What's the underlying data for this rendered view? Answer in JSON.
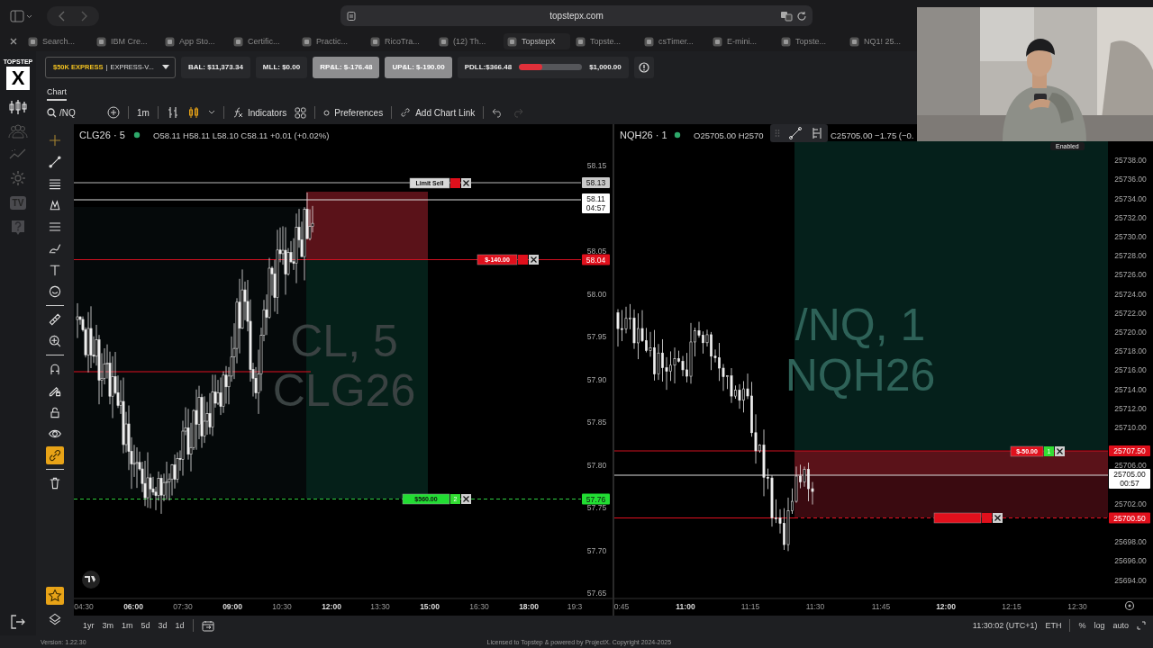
{
  "browser": {
    "url": "topstepx.com",
    "tabs": [
      {
        "label": "Search...",
        "selected": false
      },
      {
        "label": "IBM Cre...",
        "selected": false
      },
      {
        "label": "App Sto...",
        "selected": false
      },
      {
        "label": "Certific...",
        "selected": false
      },
      {
        "label": "Practic...",
        "selected": false
      },
      {
        "label": "RicoTra...",
        "selected": false
      },
      {
        "label": "(12) Th...",
        "selected": false
      },
      {
        "label": "TopstepX",
        "selected": true
      },
      {
        "label": "Topste...",
        "selected": false
      },
      {
        "label": "csTimer...",
        "selected": false
      },
      {
        "label": "E-mini...",
        "selected": false
      },
      {
        "label": "Topste...",
        "selected": false
      },
      {
        "label": "NQ1! 25...",
        "selected": false
      }
    ]
  },
  "logo": {
    "top": "TOPSTEP",
    "mark": "X"
  },
  "rail": {
    "tv_badge": "TV"
  },
  "account": {
    "plan": "$50K EXPRESS",
    "separator": "|",
    "name": "EXPRESS-V...",
    "stats": [
      {
        "label": "BAL: $11,373.34",
        "kind": "plain"
      },
      {
        "label": "MLL: $0.00",
        "kind": "plain"
      },
      {
        "label": "RP&L: $-176.48",
        "kind": "highlight"
      },
      {
        "label": "UP&L: $-190.00",
        "kind": "highlight"
      }
    ],
    "pdll": {
      "label": "PDLL:$366.48",
      "level": 0.37,
      "limit": "$1,000.00"
    }
  },
  "chart_tabs": [
    {
      "label": "Chart",
      "selected": true
    }
  ],
  "toolbar": {
    "symbol": "/NQ",
    "interval": "1m",
    "indicators": "Indicators",
    "preferences": "Preferences",
    "chart_link": "Add Chart Link"
  },
  "drawing_tools": [
    {
      "selected": false
    },
    {
      "selected": false
    },
    {
      "selected": false
    },
    {
      "selected": false
    },
    {
      "selected": false
    },
    {
      "selected": false
    },
    {
      "selected": false
    },
    {
      "selected": false
    },
    {
      "selected": false
    },
    {
      "selected": false
    },
    {
      "selected": false
    },
    {
      "selected": false
    },
    {
      "selected": false
    },
    {
      "selected": false
    },
    {
      "selected": true
    },
    {
      "selected": false
    }
  ],
  "favorites": {
    "selected": true
  },
  "charts": [
    {
      "symbol": "CLG26 · 5",
      "ohlc": [
        "O58.11 H58.11 L58.10 C58.11 +0.01 (+0.02%)"
      ],
      "watermark": [
        "CL, 5",
        "CLG26"
      ],
      "yticks": [
        "58.15",
        "58.05",
        "58.00",
        "57.95",
        "57.90",
        "57.85",
        "57.80",
        "57.75",
        "57.70",
        "57.65"
      ],
      "xticks": [
        {
          "label": "04:30",
          "major": false
        },
        {
          "label": "06:00",
          "major": true
        },
        {
          "label": "07:30",
          "major": false
        },
        {
          "label": "09:00",
          "major": true
        },
        {
          "label": "10:30",
          "major": false
        },
        {
          "label": "12:00",
          "major": true
        },
        {
          "label": "13:30",
          "major": false
        },
        {
          "label": "15:00",
          "major": true
        },
        {
          "label": "16:30",
          "major": false
        },
        {
          "label": "18:00",
          "major": true
        },
        {
          "label": "19:3",
          "major": false
        }
      ],
      "price_tags": [
        {
          "label": "58.13",
          "kind": "order"
        },
        {
          "label": "58.11",
          "sub": "04:57",
          "kind": "last"
        },
        {
          "label": "58.04",
          "kind": "loss"
        },
        {
          "label": "57.76",
          "kind": "profit"
        }
      ],
      "orders": [
        {
          "label": "Limit Sell",
          "kind": "pending"
        },
        {
          "label": "$-140.00",
          "kind": "loss"
        },
        {
          "label": "$560.00",
          "qty": "2",
          "kind": "profit"
        }
      ]
    },
    {
      "symbol": "NQH26 · 1",
      "ohlc": [
        "O25705.00 H2570",
        "C25705.00 −1.75 (−0."
      ],
      "watermark": [
        "/NQ, 1",
        "NQH26"
      ],
      "yticks": [
        "25738.00",
        "25736.00",
        "25734.00",
        "25732.00",
        "25730.00",
        "25728.00",
        "25726.00",
        "25724.00",
        "25722.00",
        "25720.00",
        "25718.00",
        "25716.00",
        "25714.00",
        "25712.00",
        "25710.00",
        "25706.00",
        "25702.00",
        "25698.00",
        "25696.00",
        "25694.00"
      ],
      "xticks": [
        {
          "label": "0:45",
          "major": false
        },
        {
          "label": "11:00",
          "major": true
        },
        {
          "label": "11:15",
          "major": false
        },
        {
          "label": "11:30",
          "major": false
        },
        {
          "label": "11:45",
          "major": false
        },
        {
          "label": "12:00",
          "major": true
        },
        {
          "label": "12:15",
          "major": false
        },
        {
          "label": "12:30",
          "major": false
        }
      ],
      "price_tags": [
        {
          "label": "25707.50",
          "kind": "loss"
        },
        {
          "label": "25705.00",
          "sub": "00:57",
          "kind": "last"
        },
        {
          "label": "25700.50",
          "kind": "loss"
        }
      ],
      "orders": [
        {
          "label": "$-50.00",
          "qty": "1",
          "kind": "loss"
        },
        {
          "kind": "loss"
        }
      ]
    }
  ],
  "badge": "Enabled",
  "bottom_bar": {
    "ranges": [
      "1yr",
      "3m",
      "1m",
      "5d",
      "3d",
      "1d"
    ],
    "clock": "11:30:02 (UTC+1)",
    "session": "ETH",
    "options": [
      "%",
      "log",
      "auto"
    ]
  },
  "footer": {
    "version": "Version: 1.22.30",
    "license": "Licensed to Topstep & powered by ProjectX. Copyright 2024-2025"
  }
}
